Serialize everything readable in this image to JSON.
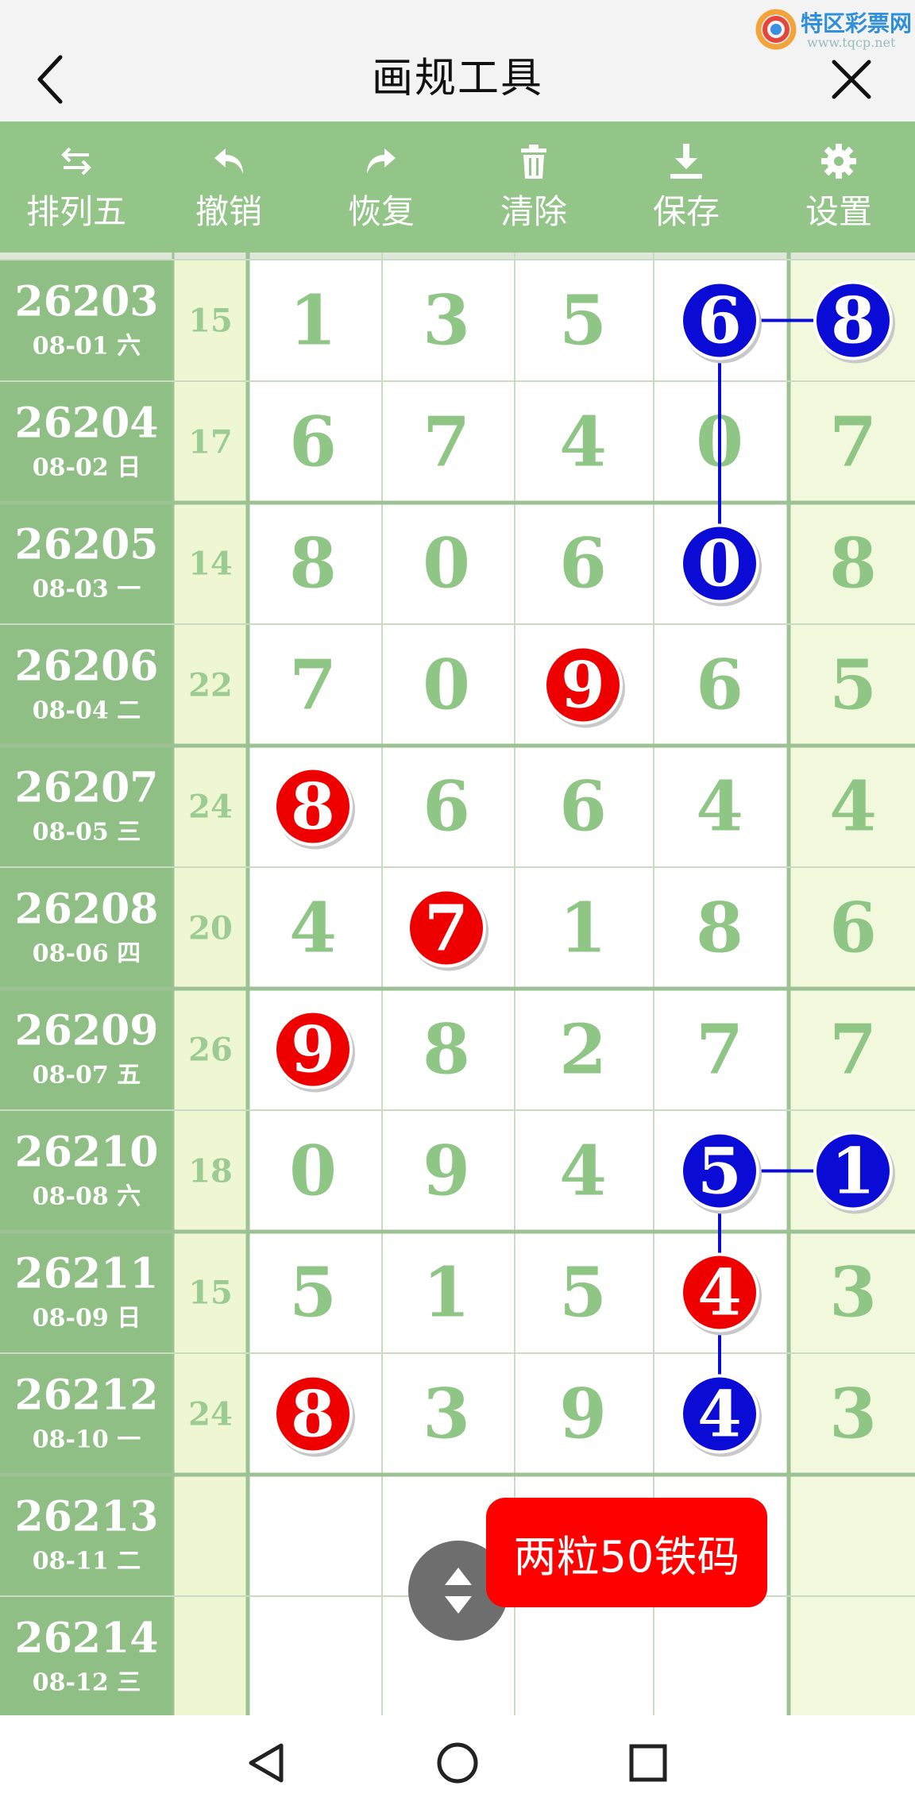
{
  "title": "画规工具",
  "logo": {
    "name": "特区彩票网",
    "url": "www.tqcp.net"
  },
  "toolbar": [
    {
      "label": "排列五",
      "icon": "swap-arrows-icon"
    },
    {
      "label": "撤销",
      "icon": "undo-icon"
    },
    {
      "label": "恢复",
      "icon": "redo-icon"
    },
    {
      "label": "清除",
      "icon": "trash-icon"
    },
    {
      "label": "保存",
      "icon": "download-icon"
    },
    {
      "label": "设置",
      "icon": "gear-icon"
    }
  ],
  "rows": [
    {
      "id": "26203",
      "date": "08-01 六",
      "sum": "15",
      "digits": [
        "1",
        "3",
        "5",
        "6",
        "8"
      ]
    },
    {
      "id": "26204",
      "date": "08-02 日",
      "sum": "17",
      "digits": [
        "6",
        "7",
        "4",
        "0",
        "7"
      ]
    },
    {
      "id": "26205",
      "date": "08-03 一",
      "sum": "14",
      "digits": [
        "8",
        "0",
        "6",
        "0",
        "8"
      ]
    },
    {
      "id": "26206",
      "date": "08-04 二",
      "sum": "22",
      "digits": [
        "7",
        "0",
        "9",
        "6",
        "5"
      ]
    },
    {
      "id": "26207",
      "date": "08-05 三",
      "sum": "24",
      "digits": [
        "8",
        "6",
        "6",
        "4",
        "4"
      ]
    },
    {
      "id": "26208",
      "date": "08-06 四",
      "sum": "20",
      "digits": [
        "4",
        "7",
        "1",
        "8",
        "6"
      ]
    },
    {
      "id": "26209",
      "date": "08-07 五",
      "sum": "26",
      "digits": [
        "9",
        "8",
        "2",
        "7",
        "7"
      ]
    },
    {
      "id": "26210",
      "date": "08-08 六",
      "sum": "18",
      "digits": [
        "0",
        "9",
        "4",
        "5",
        "1"
      ]
    },
    {
      "id": "26211",
      "date": "08-09 日",
      "sum": "15",
      "digits": [
        "5",
        "1",
        "5",
        "4",
        "3"
      ]
    },
    {
      "id": "26212",
      "date": "08-10 一",
      "sum": "24",
      "digits": [
        "8",
        "3",
        "9",
        "4",
        "3"
      ]
    },
    {
      "id": "26213",
      "date": "08-11 二",
      "sum": "",
      "digits": [
        "",
        "",
        "",
        "",
        ""
      ]
    },
    {
      "id": "26214",
      "date": "08-12 三",
      "sum": "",
      "digits": [
        "",
        "",
        "",
        "",
        ""
      ]
    }
  ],
  "marks": [
    {
      "row": 0,
      "col": 3,
      "color": "blue"
    },
    {
      "row": 0,
      "col": 4,
      "color": "blue"
    },
    {
      "row": 2,
      "col": 3,
      "color": "blue"
    },
    {
      "row": 3,
      "col": 2,
      "color": "red"
    },
    {
      "row": 4,
      "col": 0,
      "color": "red"
    },
    {
      "row": 5,
      "col": 1,
      "color": "red"
    },
    {
      "row": 6,
      "col": 0,
      "color": "red"
    },
    {
      "row": 7,
      "col": 3,
      "color": "blue"
    },
    {
      "row": 7,
      "col": 4,
      "color": "blue"
    },
    {
      "row": 8,
      "col": 3,
      "color": "red"
    },
    {
      "row": 9,
      "col": 0,
      "color": "red"
    },
    {
      "row": 9,
      "col": 3,
      "color": "blue"
    }
  ],
  "links": [
    {
      "from": [
        0,
        3
      ],
      "to": [
        0,
        4
      ]
    },
    {
      "from": [
        0,
        3
      ],
      "to": [
        2,
        3
      ]
    },
    {
      "from": [
        7,
        3
      ],
      "to": [
        7,
        4
      ]
    },
    {
      "from": [
        7,
        3
      ],
      "to": [
        8,
        3
      ]
    },
    {
      "from": [
        8,
        3
      ],
      "to": [
        9,
        3
      ]
    }
  ],
  "float_button": {
    "label": "两粒50铁码"
  },
  "colors": {
    "header_green": "#93c588",
    "id_column_green": "#8fbf84",
    "sum_column_bg": "#eef7d2",
    "last_column_bg": "#f1f8dc",
    "digit_green": "#8fc585",
    "grid_line": "#c9dcc3",
    "group_line": "#9cc194",
    "ball_red": "#ee0000",
    "ball_blue": "#0b0bd6",
    "float_red": "#ff0000"
  }
}
